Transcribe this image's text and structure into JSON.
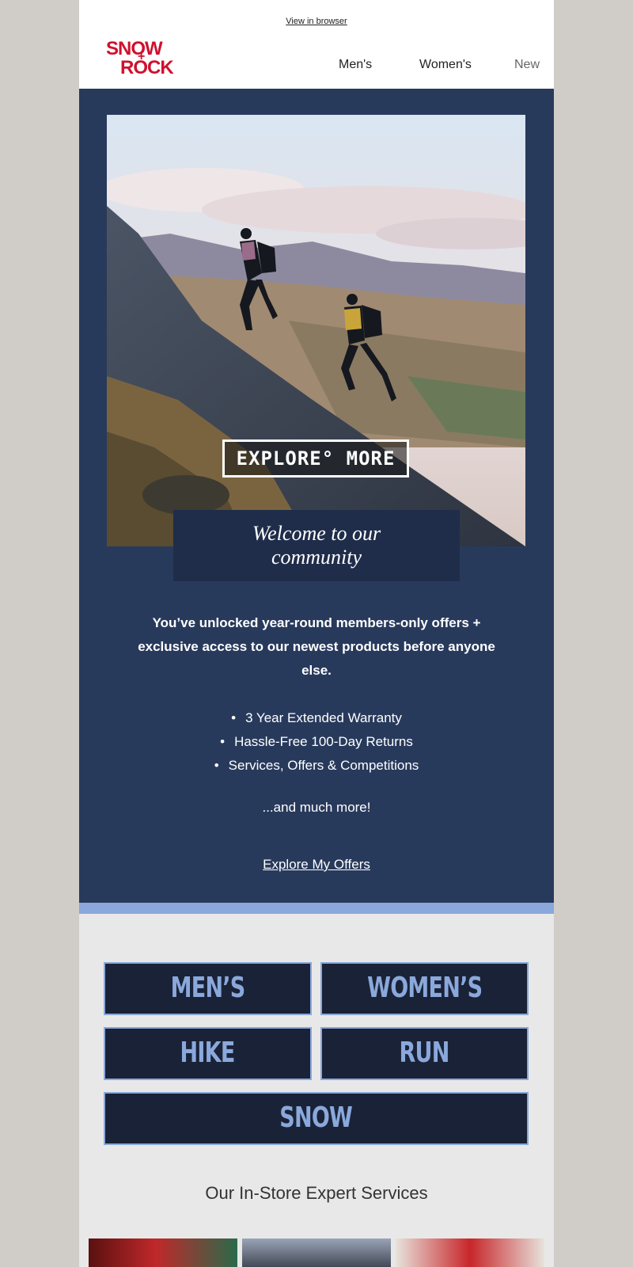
{
  "header": {
    "view_in_browser": "View in browser",
    "logo_line1": "SNOW",
    "logo_plus": "+",
    "logo_line2": "ROCK",
    "nav": [
      "Men's",
      "Women's",
      "New"
    ]
  },
  "hero": {
    "badge": "EXPLORE° MORE",
    "welcome_line1": "Welcome to our",
    "welcome_line2": "community",
    "intro": "You’ve unlocked year-round members-only offers + exclusive access to our newest products before anyone else.",
    "benefits": [
      "3 Year Extended Warranty",
      "Hassle-Free 100-Day Returns",
      "Services, Offers & Competitions"
    ],
    "more": "...and much more!",
    "cta": "Explore My Offers"
  },
  "categories": {
    "mens": "MEN’S",
    "womens": "WOMEN’S",
    "hike": "HIKE",
    "run": "RUN",
    "snow": "SNOW"
  },
  "services": {
    "title": "Our In-Store Expert Services"
  },
  "colors": {
    "brand_red": "#d0102e",
    "navy": "#283a5c",
    "accent_blue": "#8aa8db"
  }
}
